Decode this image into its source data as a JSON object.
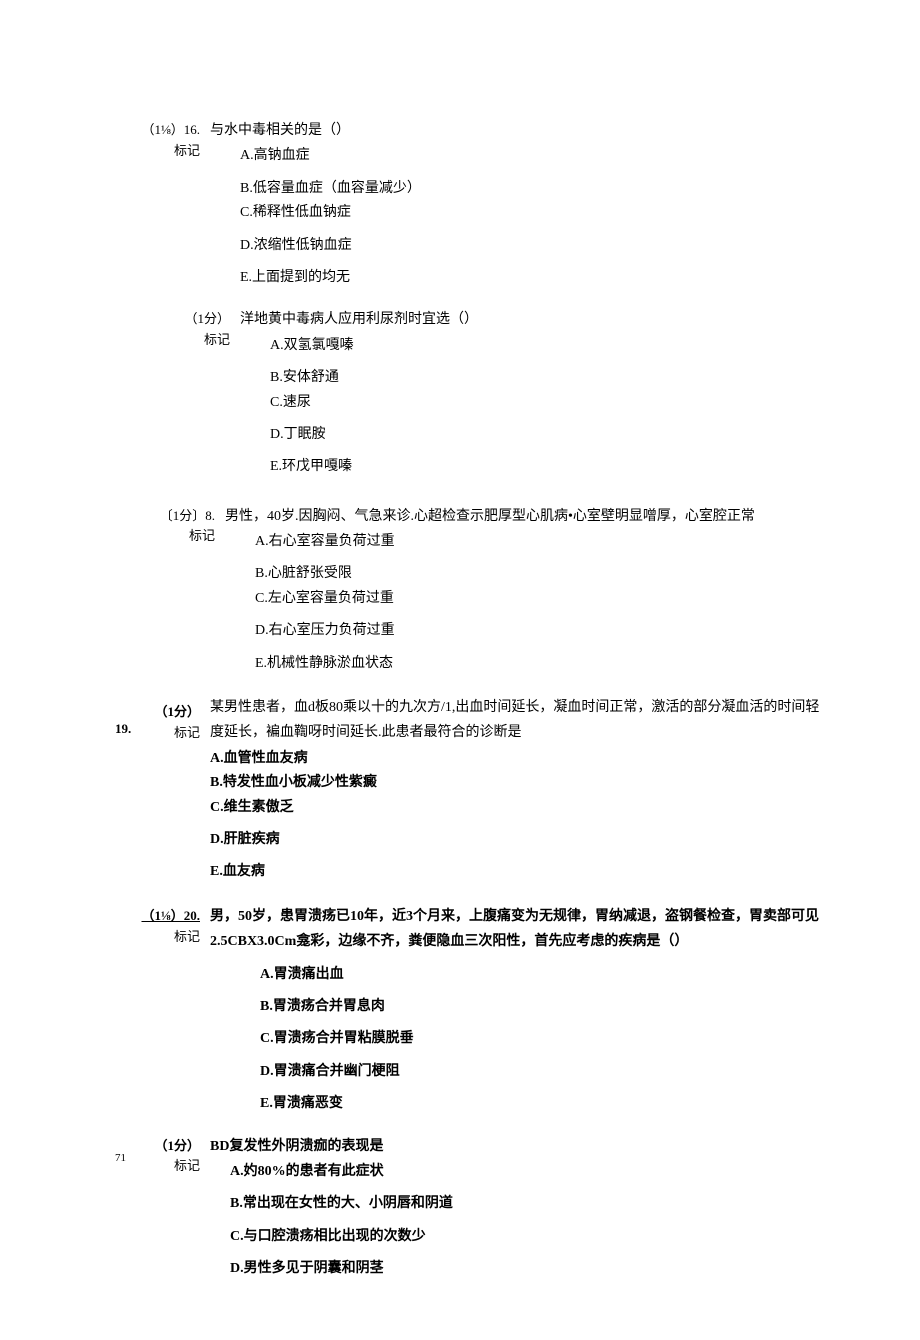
{
  "q16": {
    "score": "（1⅛）16.",
    "mark": "标记",
    "question": "与水中毒相关的是（）",
    "opts": {
      "a": "A.高钠血症",
      "b": "B.低容量血症（血容量减少）",
      "c": "C.稀释性低血钠症",
      "d": "D.浓缩性低钠血症",
      "e": "E.上面提到的均无"
    }
  },
  "q17": {
    "score": "（1分）",
    "mark": "标记",
    "question": "洋地黄中毒病人应用利尿剂时宜选（）",
    "opts": {
      "a": "A.双氢氯嘎嗪",
      "b": "B.安体舒通",
      "c": "C.速尿",
      "d": "D.丁眠胺",
      "e": "E.环戊甲嘎嗪"
    }
  },
  "q18": {
    "score": "〔1分〕8.",
    "mark": "标记",
    "question": "男性，40岁.因胸闷、气急来诊.心超检查示肥厚型心肌病•心室壁明显噌厚，心室腔正常",
    "opts": {
      "a": "A.右心室容量负荷过重",
      "b": "B.心脏舒张受限",
      "c": "C.左心室容量负荷过重",
      "d": "D.右心室压力负荷过重",
      "e": "E.机械性静脉淤血状态"
    }
  },
  "q19": {
    "num": "19.",
    "score": "（1分）",
    "mark": "标记",
    "line1": "某男性患者，血d板80乘以十的九次方/1,出血时间延长，凝血时间正常，激活的部分凝血活的时间轻",
    "line2": "度延长，褊血鞫呀时间延长.此患者最符合的诊断是",
    "opts": {
      "a": "A.血管性血友病",
      "b": "B.特发性血小板减少性紫癜",
      "c": "C.维生素傲乏",
      "d": "D.肝脏疾病",
      "e": "E.血友病"
    }
  },
  "q20": {
    "score": "（1⅛）20.",
    "mark": "标记",
    "line1": "男，50岁，患胃溃疡已10年，近3个月来，上腹痛变为无规律，胃纳减退，盗钢餐检查，胃卖部可见",
    "line2": "2.5CBX3.0Cm龛彩，边缘不齐，粪便隐血三次阳性，首先应考虑的疾病是（）",
    "opts": {
      "a": "A.胃溃痛出血",
      "b": "B.胃溃疡合并胃息肉",
      "c": "C.胃溃疡合并胃粘膜脱垂",
      "d": "D.胃溃痛合并幽门梗阻",
      "e": "E.胃溃痛恶变"
    }
  },
  "q21": {
    "num": "71",
    "score": "（1分）",
    "mark": "标记",
    "question": "BD复发性外阴溃痂的表现是",
    "opts": {
      "a": "A.妁80%的患者有此症状",
      "b": "B.常出现在女性的大、小阴唇和阴道",
      "c": "C.与口腔溃疡相比出现的次数少",
      "d": "D.男性多见于阴囊和阴茎"
    }
  }
}
